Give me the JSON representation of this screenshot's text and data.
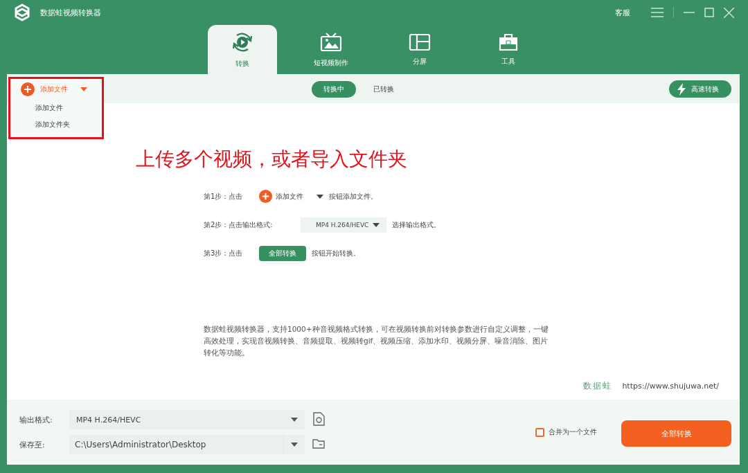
{
  "window": {
    "title": "数据蛙视频转换器",
    "service": "客服"
  },
  "tabs": [
    {
      "label": "转换",
      "kind": "convert",
      "selected": true
    },
    {
      "label": "短视频制作",
      "kind": "tv",
      "selected": false
    },
    {
      "label": "分屏",
      "kind": "split",
      "selected": false
    },
    {
      "label": "工具",
      "kind": "toolbox",
      "selected": false
    }
  ],
  "toolbar": {
    "add_button": "添加文件",
    "menu": [
      "添加文件",
      "添加文件夹"
    ],
    "segments": [
      {
        "label": "转换中",
        "selected": true
      },
      {
        "label": "已转换",
        "selected": false
      }
    ],
    "speed_button": "高速转换"
  },
  "annotation": "上传多个视频，或者导入文件夹",
  "steps": [
    {
      "kind": "add",
      "prefix": "第1步：点击",
      "control": "添加文件",
      "suffix": "按钮添加文件。"
    },
    {
      "kind": "select",
      "prefix": "第2步：点击输出格式:",
      "control": "MP4 H.264/HEVC",
      "suffix": "选择输出格式。"
    },
    {
      "kind": "button",
      "prefix": "第3步：点击",
      "control": "全部转换",
      "suffix": "按钮开始转换。"
    }
  ],
  "description": "数据蛙视频转换器，支持1000+种音视频格式转换，可在视频转换前对转换参数进行自定义调整，一键高效处理，实现音视频转换、音频提取、视频转gif、视频压缩、添加水印、视频分屏、噪音消除、图片转化等功能。",
  "site": {
    "brand": "数据蛙",
    "url": "https://www.shujuwa.net/"
  },
  "bottom": {
    "format": {
      "label": "输出格式:",
      "value": "MP4 H.264/HEVC"
    },
    "save": {
      "label": "保存至:",
      "value": "C:\\Users\\Administrator\\Desktop"
    },
    "merge": {
      "label": "合并为一个文件",
      "checked": false
    },
    "convert_button": "全部转换"
  }
}
